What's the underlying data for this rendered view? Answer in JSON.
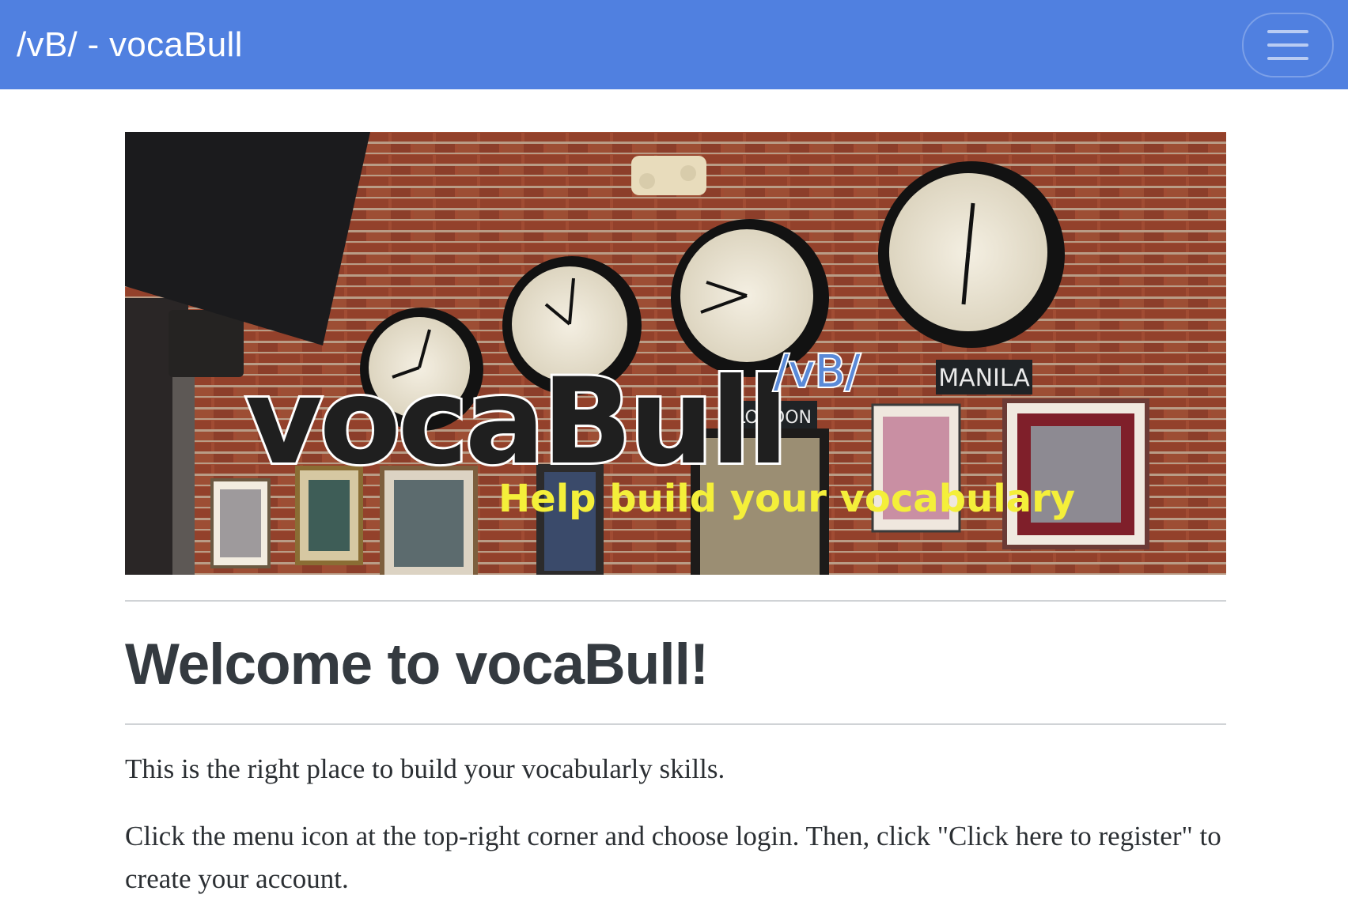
{
  "navbar": {
    "brand": "/vB/ - vocaBull",
    "menu_icon": "hamburger-menu-icon",
    "background": "#5080e0"
  },
  "hero": {
    "logo_text": "vocaBull",
    "logo_tag": "/vB/",
    "tagline": "Help build your vocabulary",
    "sign_manila": "MANILA",
    "sign_london": "LONDON"
  },
  "main": {
    "heading": "Welcome to vocaBull!",
    "intro": "This is the right place to build your vocabularly skills.",
    "instructions": "Click the menu icon at the top-right corner and choose login. Then, click \"Click here to register\" to create your account."
  }
}
